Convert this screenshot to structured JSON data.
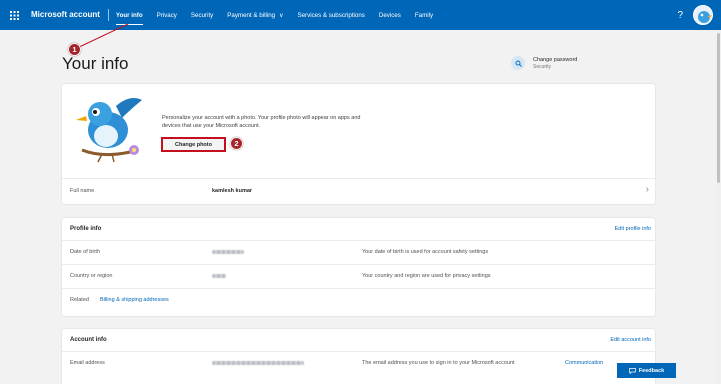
{
  "topbar": {
    "brand": "Microsoft account",
    "nav": [
      {
        "label": "Your info",
        "active": true
      },
      {
        "label": "Privacy"
      },
      {
        "label": "Security"
      },
      {
        "label": "Payment & billing",
        "chevron": "∨"
      },
      {
        "label": "Services & subscriptions"
      },
      {
        "label": "Devices"
      },
      {
        "label": "Family"
      }
    ],
    "help": "?"
  },
  "annotations": {
    "badge1": "1",
    "badge2": "2",
    "color": "#a4262c"
  },
  "page": {
    "title": "Your info"
  },
  "change_password": {
    "label": "Change password",
    "sublabel": "Security"
  },
  "photo_card": {
    "description": "Personalize your account with a photo. Your profile photo will appear on apps and devices that use your Microsoft account.",
    "button": "Change photo",
    "full_name_label": "Full name",
    "full_name_value": "kamlesh kumar"
  },
  "profile_info": {
    "heading": "Profile info",
    "edit_link": "Edit profile info",
    "rows": [
      {
        "label": "Date of birth",
        "note": "Your date of birth is used for account safety settings"
      },
      {
        "label": "Country or region",
        "note": "Your country and region are used for privacy settings"
      }
    ],
    "related_label": "Related",
    "related_link": "Billing & shipping addresses"
  },
  "account_info": {
    "heading": "Account info",
    "edit_link": "Edit account info",
    "email_label": "Email address",
    "email_note": "The email address you use to sign in to your Microsoft account",
    "comm_link": "Communication"
  },
  "feedback": "Feedback",
  "colors": {
    "accent": "#0067b8",
    "background": "#f2f2f2"
  }
}
